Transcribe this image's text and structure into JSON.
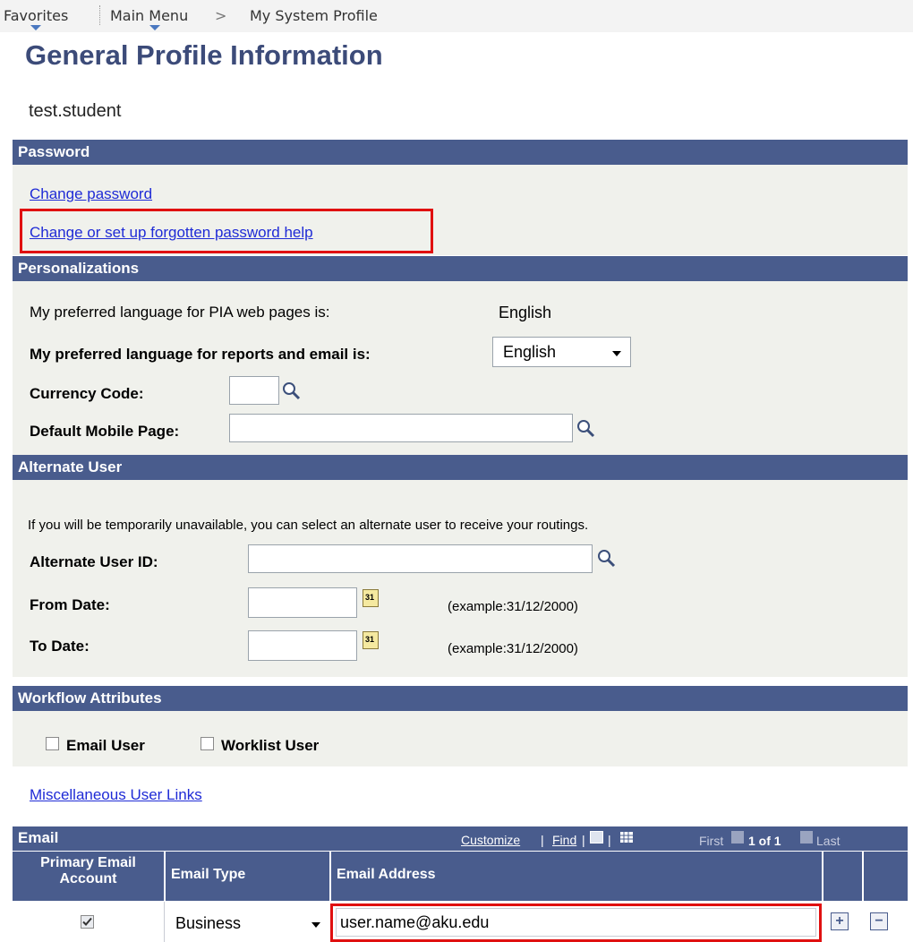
{
  "nav": {
    "favorites": "Favorites",
    "main_menu": "Main Menu",
    "separator": ">",
    "current": "My System Profile"
  },
  "page": {
    "title": "General Profile Information",
    "user": "test.student"
  },
  "password": {
    "header": "Password",
    "change_password": "Change password",
    "forgotten_help": "Change or set up forgotten password help"
  },
  "personalizations": {
    "header": "Personalizations",
    "pia_label": "My preferred language for PIA web pages is:",
    "pia_value": "English",
    "reports_label": "My preferred language for reports and email is:",
    "reports_value": "English",
    "currency_label": "Currency Code:",
    "currency_value": "",
    "mobile_label": "Default Mobile Page:",
    "mobile_value": ""
  },
  "alternate_user": {
    "header": "Alternate User",
    "info": "If you will be temporarily unavailable, you can select an alternate user to receive your routings.",
    "user_id_label": "Alternate User ID:",
    "user_id_value": "",
    "from_label": "From Date:",
    "from_value": "",
    "from_example": "(example:31/12/2000)",
    "to_label": "To Date:",
    "to_value": "",
    "to_example": "(example:31/12/2000)",
    "calendar_day": "31"
  },
  "workflow": {
    "header": "Workflow Attributes",
    "email_user": "Email User",
    "worklist_user": "Worklist User",
    "email_user_checked": false,
    "worklist_user_checked": false
  },
  "misc_link": "Miscellaneous User Links",
  "email_grid": {
    "title": "Email",
    "customize": "Customize",
    "find": "Find",
    "pipe": "|",
    "first": "First",
    "range": "1 of 1",
    "last": "Last",
    "columns": [
      "Primary Email Account",
      "Email Type",
      "Email Address"
    ],
    "rows": [
      {
        "primary": true,
        "type": "Business",
        "address": "user.name@aku.edu"
      }
    ],
    "add": "+",
    "remove": "−"
  },
  "colors": {
    "bar": "#495c8d",
    "title": "#3c4b79",
    "link": "#1f2bd6",
    "highlight": "#e01010",
    "panel": "#f0f1ec"
  }
}
